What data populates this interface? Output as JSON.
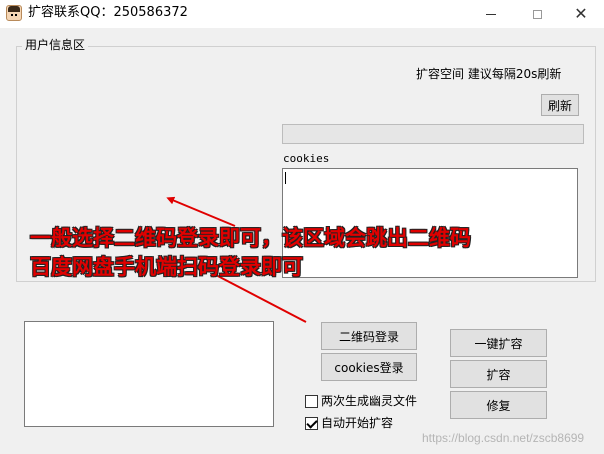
{
  "window": {
    "title": "扩容联系QQ：250586372",
    "close_glyph": "✕"
  },
  "user_info": {
    "group_title": "用户信息区",
    "hint": "扩容空间 建议每隔20s刷新",
    "refresh_label": "刷新",
    "progress": 0,
    "cookies_label": "cookies",
    "cookies_value": ""
  },
  "annotation": {
    "line1": "一般选择二维码登录即可，该区域会跳出二维码",
    "line2": "百度网盘手机端扫码登录即可",
    "color": "#e00000"
  },
  "actions": {
    "qr_login": "二维码登录",
    "cookies_login": "cookies登录",
    "one_click_expand": "一键扩容",
    "expand": "扩容",
    "repair": "修复",
    "option_twice_ghost": "两次生成幽灵文件",
    "option_auto_start": "自动开始扩容",
    "option_twice_ghost_checked": false,
    "option_auto_start_checked": true
  },
  "log": {
    "value": ""
  },
  "watermark": "https://blog.csdn.net/zscb8699"
}
